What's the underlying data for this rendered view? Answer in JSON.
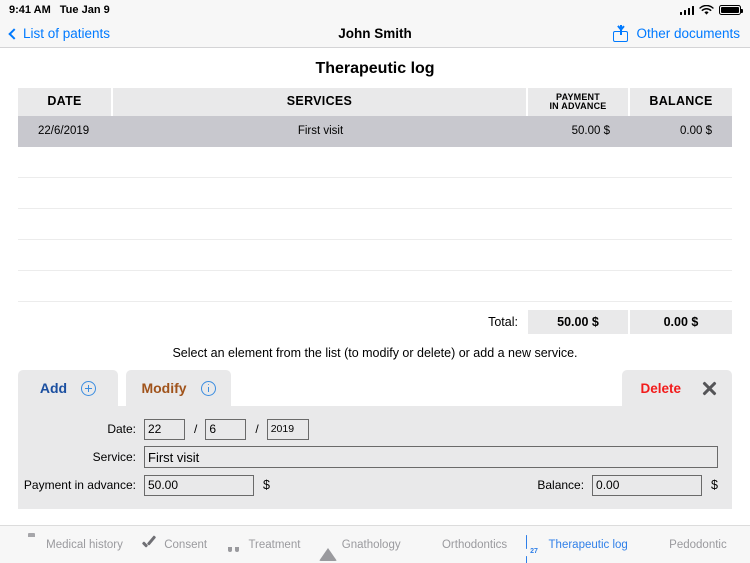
{
  "status_bar": {
    "time": "9:41 AM",
    "date": "Tue Jan 9"
  },
  "nav_bar": {
    "back_label": "List of patients",
    "title": "John Smith",
    "right_link": "Other documents"
  },
  "page": {
    "heading": "Therapeutic log",
    "hint": "Select an element from the list (to modify or delete) or add a new service."
  },
  "table": {
    "headers": {
      "date": "DATE",
      "services": "SERVICES",
      "payment_line1": "PAYMENT",
      "payment_line2": "IN ADVANCE",
      "balance": "BALANCE"
    },
    "rows": [
      {
        "date": "22/6/2019",
        "service": "First visit",
        "payment": "50.00 $",
        "balance": "0.00 $"
      }
    ],
    "empty_row_count": 5,
    "total": {
      "label": "Total:",
      "payment": "50.00 $",
      "balance": "0.00 $"
    }
  },
  "editor": {
    "tabs": {
      "add_label": "Add",
      "add_icon": "plus-circle-icon",
      "modify_label": "Modify",
      "modify_icon": "info-circle-icon"
    },
    "delete_label": "Delete",
    "close_icon": "close-x-icon",
    "fields": {
      "date_label": "Date:",
      "date_day": "22",
      "date_month": "6",
      "date_year": "2019",
      "date_separator": "/",
      "service_label": "Service:",
      "service_value": "First visit",
      "payment_label": "Payment in advance:",
      "payment_value": "50.00",
      "balance_label": "Balance:",
      "balance_value": "0.00",
      "currency": "$"
    }
  },
  "tabbar": {
    "items": [
      {
        "label": "Medical history",
        "icon": "medical-kit-icon",
        "active": false
      },
      {
        "label": "Consent",
        "icon": "checkmark-icon",
        "active": false
      },
      {
        "label": "Treatment",
        "icon": "tooth-icon",
        "active": false
      },
      {
        "label": "Gnathology",
        "icon": "triangle-icon",
        "active": false
      },
      {
        "label": "Orthodontics",
        "icon": "braces-icon",
        "active": false
      },
      {
        "label": "Therapeutic log",
        "icon": "calendar-icon",
        "active": true
      },
      {
        "label": "Pedodontic",
        "icon": "smiley-icon",
        "active": false
      }
    ],
    "calendar_day": "27"
  },
  "colors": {
    "accent_blue": "#007aff",
    "tab_active_blue": "#2f7fe8",
    "delete_red": "#f21c1c",
    "add_blue": "#1b4fa0",
    "modify_brown": "#a0531b",
    "panel_gray": "#e9e9ea",
    "row_selected": "#c8c8ce"
  }
}
